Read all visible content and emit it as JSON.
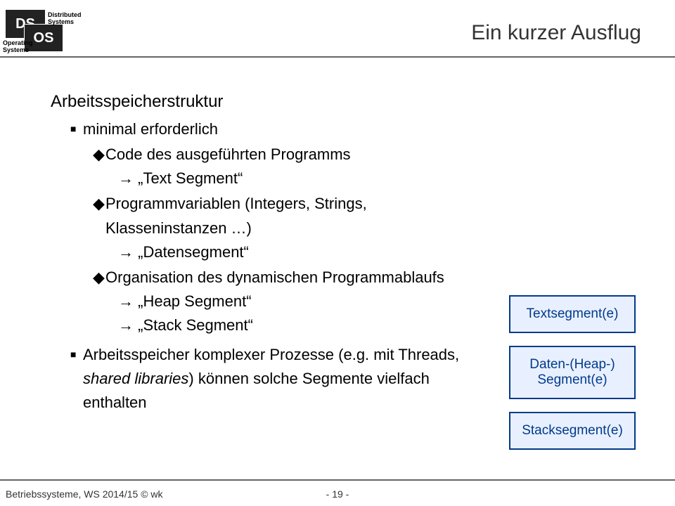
{
  "header": {
    "logo": {
      "block1": "DS",
      "block2": "OS",
      "label1_line1": "Distributed",
      "label1_line2": "Systems",
      "label2_line1": "Operating",
      "label2_line2": "Systems"
    },
    "title": "Ein kurzer Ausflug"
  },
  "content": {
    "heading": "Arbeitsspeicherstruktur",
    "l1_a": "minimal erforderlich",
    "l2_a": "Code des ausgeführten Programms",
    "l3_a": "„Text Segment“",
    "l2_b": "Programmvariablen (Integers, Strings, Klasseninstanzen …)",
    "l3_b": "„Datensegment“",
    "l2_c": "Organisation des dynamischen Programmablaufs",
    "l3_c": "„Heap Segment“",
    "l3_d": "„Stack Segment“",
    "l1_b_pre": "Arbeitsspeicher komplexer Prozesse (e.g. mit Threads, ",
    "l1_b_italic": "shared libraries",
    "l1_b_post": ") können solche Segmente vielfach enthalten"
  },
  "sidebar": {
    "box1": "Textsegment(e)",
    "box2_line1": "Daten-(Heap-)",
    "box2_line2": "Segment(e)",
    "box3": "Stacksegment(e)"
  },
  "footer": {
    "left": "Betriebssysteme, WS 2014/15 © wk",
    "center": "- 19 -"
  }
}
